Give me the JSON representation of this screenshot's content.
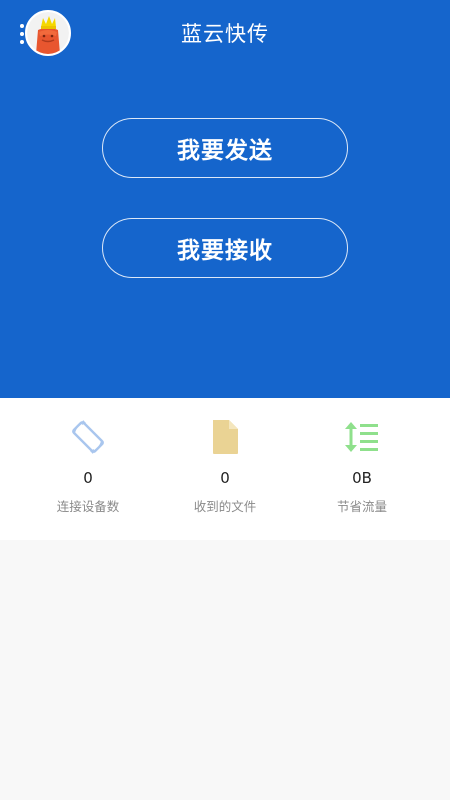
{
  "header": {
    "title": "蓝云快传",
    "menu_icon": "more-vertical-icon",
    "avatar_icon": "avatar-icon"
  },
  "actions": {
    "send_label": "我要发送",
    "receive_label": "我要接收"
  },
  "stats": [
    {
      "icon": "screen-rotation-icon",
      "value": "0",
      "label": "连接设备数",
      "color": "#a9c6ee"
    },
    {
      "icon": "file-icon",
      "value": "0",
      "label": "收到的文件",
      "color": "#ead394"
    },
    {
      "icon": "sort-list-icon",
      "value": "0B",
      "label": "节省流量",
      "color": "#8fe08c"
    }
  ],
  "colors": {
    "primary": "#1565cc",
    "background": "#f8f8f8",
    "card": "#ffffff"
  }
}
